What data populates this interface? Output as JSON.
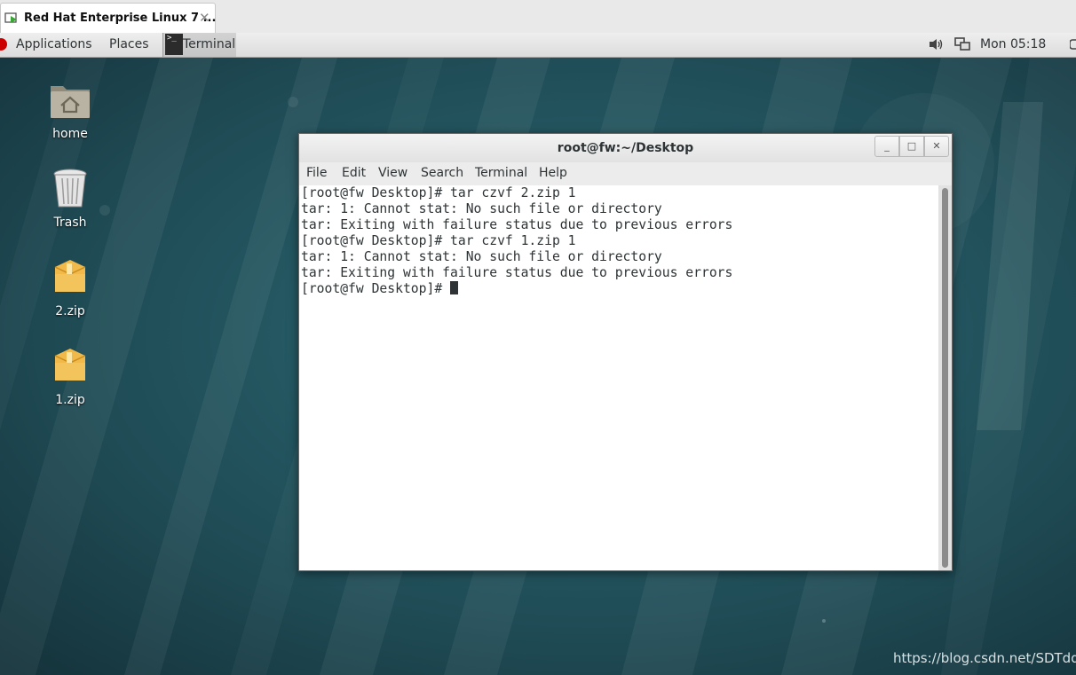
{
  "vm_tab": {
    "title": "Red Hat Enterprise Linux 7 ...",
    "close": "✕"
  },
  "panel": {
    "applications": "Applications",
    "places": "Places",
    "task_label": "Terminal",
    "clock": "Mon 05:18"
  },
  "desktop_icons": [
    {
      "label": "home",
      "icon": "home-folder-icon"
    },
    {
      "label": "Trash",
      "icon": "trash-icon"
    },
    {
      "label": "2.zip",
      "icon": "archive-icon"
    },
    {
      "label": "1.zip",
      "icon": "archive-icon"
    }
  ],
  "terminal": {
    "title": "root@fw:~/Desktop",
    "menu": [
      "File",
      "Edit",
      "View",
      "Search",
      "Terminal",
      "Help"
    ],
    "lines": [
      "[root@fw Desktop]# tar czvf 2.zip 1",
      "tar: 1: Cannot stat: No such file or directory",
      "tar: Exiting with failure status due to previous errors",
      "[root@fw Desktop]# tar czvf 1.zip 1",
      "tar: 1: Cannot stat: No such file or directory",
      "tar: Exiting with failure status due to previous errors",
      "[root@fw Desktop]# "
    ],
    "buttons": {
      "minimize": "_",
      "maximize": "□",
      "close": "✕"
    }
  },
  "watermark": "https://blog.csdn.net/SDTdd",
  "colors": {
    "desktop_bg": "#1f4650",
    "terminal_text": "#2e3436",
    "panel_bg": "#e4e4e4"
  }
}
